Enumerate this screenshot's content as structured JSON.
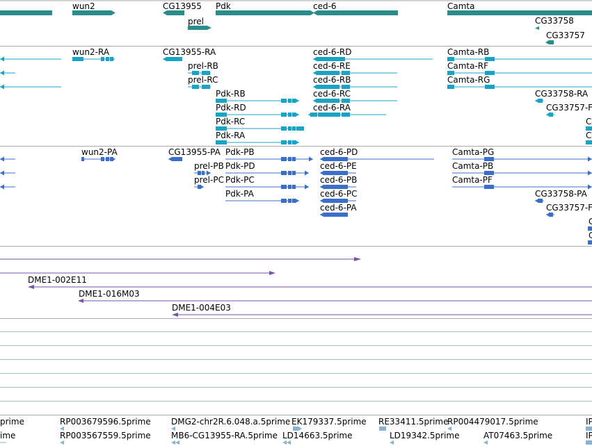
{
  "colors": {
    "gene": "#2a8c8c",
    "transcript_sim": "#1ba3c6",
    "transcript_pred": "#3a6fc9",
    "clone": "#7a52a8",
    "est": "#86b3d1",
    "separator": "#a9a9a9",
    "empty_track_line": "#9cc4d2"
  },
  "icons": {
    "forward_strand": "arrow-right-icon",
    "reverse_strand": "arrow-left-icon"
  },
  "genes": [
    {
      "id": "gene-wun2",
      "label": "wun2"
    },
    {
      "id": "gene-cg13955",
      "label": "CG13955"
    },
    {
      "id": "gene-pdk",
      "label": "Pdk"
    },
    {
      "id": "gene-ced6",
      "label": "ced-6"
    },
    {
      "id": "gene-camta",
      "label": "Camta"
    },
    {
      "id": "gene-prel",
      "label": "prel"
    },
    {
      "id": "gene-cg33758",
      "label": "CG33758"
    },
    {
      "id": "gene-cg33757",
      "label": "CG33757"
    }
  ],
  "transcripts_track1": [
    {
      "id": "t1-wun2-ra",
      "label": "wun2-RA"
    },
    {
      "id": "t1-cg13955-ra",
      "label": "CG13955-RA"
    },
    {
      "id": "t1-ced6-rd",
      "label": "ced-6-RD"
    },
    {
      "id": "t1-camta-rb",
      "label": "Camta-RB"
    },
    {
      "id": "t1-prel-rb",
      "label": "prel-RB"
    },
    {
      "id": "t1-ced6-re",
      "label": "ced-6-RE"
    },
    {
      "id": "t1-camta-rf",
      "label": "Camta-RF"
    },
    {
      "id": "t1-prel-rc",
      "label": "prel-RC"
    },
    {
      "id": "t1-ced6-rb",
      "label": "ced-6-RB"
    },
    {
      "id": "t1-camta-rg",
      "label": "Camta-RG"
    },
    {
      "id": "t1-pdk-rb",
      "label": "Pdk-RB"
    },
    {
      "id": "t1-ced6-rc",
      "label": "ced-6-RC"
    },
    {
      "id": "t1-cg33758-ra",
      "label": "CG33758-RA"
    },
    {
      "id": "t1-pdk-rd",
      "label": "Pdk-RD"
    },
    {
      "id": "t1-ced6-ra",
      "label": "ced-6-RA"
    },
    {
      "id": "t1-cg33757",
      "label": "CG33757-F"
    },
    {
      "id": "t1-pdk-rc",
      "label": "Pdk-RC"
    },
    {
      "id": "t1-pdk-ra",
      "label": "Pdk-RA"
    },
    {
      "id": "t1-c1",
      "label": "C"
    },
    {
      "id": "t1-c2",
      "label": "C"
    }
  ],
  "transcripts_track2": [
    {
      "id": "t2-wun2-pa",
      "label": "wun2-PA"
    },
    {
      "id": "t2-cg13955-pa",
      "label": "CG13955-PA"
    },
    {
      "id": "t2-pdk-pb",
      "label": "Pdk-PB"
    },
    {
      "id": "t2-ced6-pd",
      "label": "ced-6-PD"
    },
    {
      "id": "t2-camta-pg",
      "label": "Camta-PG"
    },
    {
      "id": "t2-prel-pb",
      "label": "prel-PB"
    },
    {
      "id": "t2-pdk-pd",
      "label": "Pdk-PD"
    },
    {
      "id": "t2-ced6-pe",
      "label": "ced-6-PE"
    },
    {
      "id": "t2-camta-pb",
      "label": "Camta-PB"
    },
    {
      "id": "t2-prel-pc",
      "label": "prel-PC"
    },
    {
      "id": "t2-pdk-pc",
      "label": "Pdk-PC"
    },
    {
      "id": "t2-ced6-pb",
      "label": "ced-6-PB"
    },
    {
      "id": "t2-camta-pf",
      "label": "Camta-PF"
    },
    {
      "id": "t2-pdk-pa",
      "label": "Pdk-PA"
    },
    {
      "id": "t2-ced6-pc",
      "label": "ced-6-PC"
    },
    {
      "id": "t2-cg33758-pa",
      "label": "CG33758-PA"
    },
    {
      "id": "t2-ced6-pa",
      "label": "ced-6-PA"
    },
    {
      "id": "t2-cg33757",
      "label": "CG33757-F"
    },
    {
      "id": "t2-c1",
      "label": "C"
    },
    {
      "id": "t2-c2",
      "label": "C"
    }
  ],
  "clones": [
    {
      "id": "clone-1",
      "label": ""
    },
    {
      "id": "clone-2",
      "label": ""
    },
    {
      "id": "clone-dme1-002e11",
      "label": "DME1-002E11"
    },
    {
      "id": "clone-dme1-016m03",
      "label": "DME1-016M03"
    },
    {
      "id": "clone-dme1-004e03",
      "label": "DME1-004E03"
    }
  ],
  "ests": [
    {
      "id": "est-prime-a",
      "label": "prime"
    },
    {
      "id": "est-rp003679596",
      "label": "RP003679596.5prime"
    },
    {
      "id": "est-dmg2",
      "label": "DMG2-chr2R.6.048.a.5prime"
    },
    {
      "id": "est-ek179337",
      "label": "EK179337.5prime"
    },
    {
      "id": "est-re33411",
      "label": "RE33411.5prime"
    },
    {
      "id": "est-rp004479017",
      "label": "RP004479017.5prime"
    },
    {
      "id": "est-ip-a",
      "label": "IP"
    },
    {
      "id": "est-prime-b",
      "label": "ime"
    },
    {
      "id": "est-rp003567559",
      "label": "RP003567559.5prime"
    },
    {
      "id": "est-mb6",
      "label": "MB6-CG13955-RA.5prime"
    },
    {
      "id": "est-ld14663",
      "label": "LD14663.5prime"
    },
    {
      "id": "est-ld19342",
      "label": "LD19342.5prime"
    },
    {
      "id": "est-at07463",
      "label": "AT07463.5prime"
    },
    {
      "id": "est-ip-b",
      "label": "IP"
    }
  ]
}
